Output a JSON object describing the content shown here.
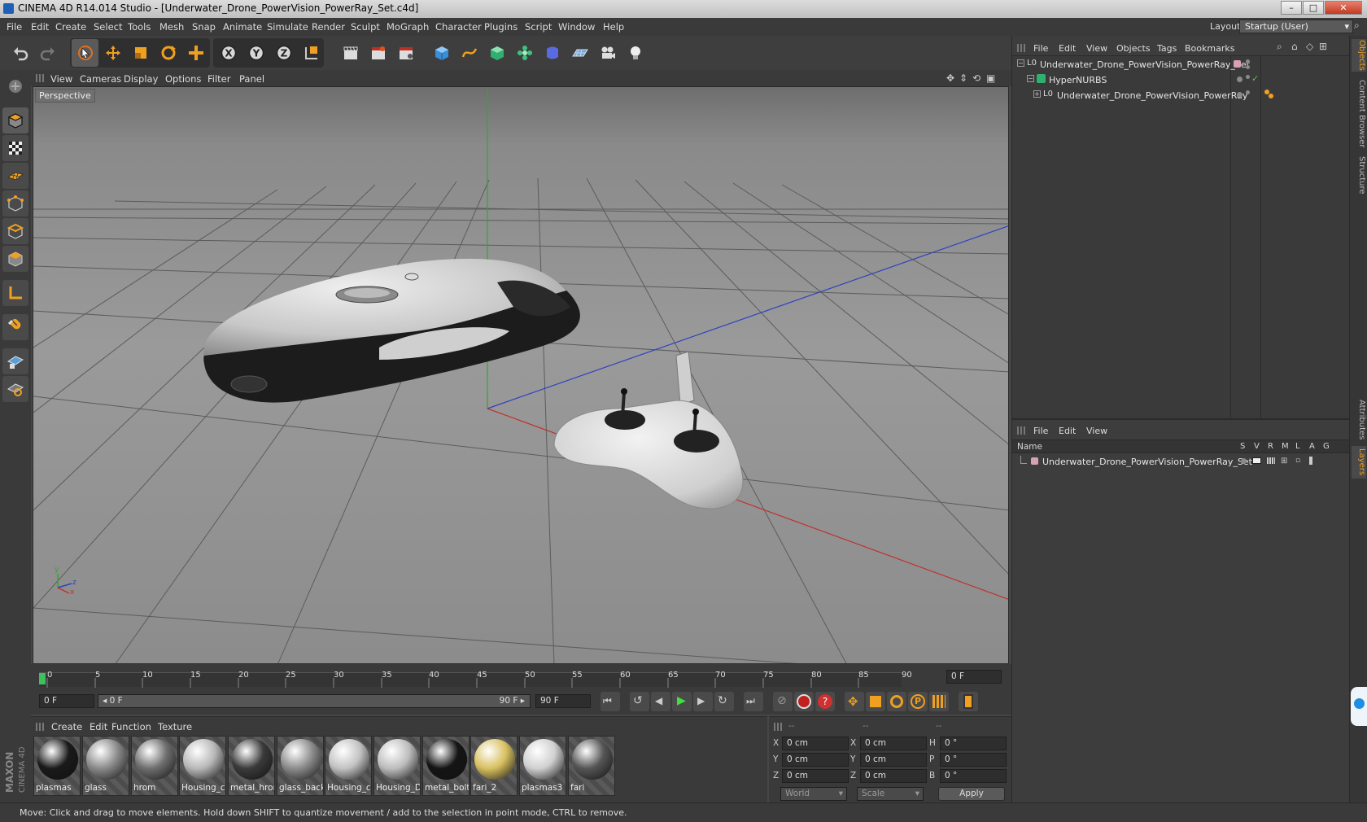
{
  "window": {
    "title": "CINEMA 4D R14.014 Studio - [Underwater_Drone_PowerVision_PowerRay_Set.c4d]",
    "btn_min": "–",
    "btn_max": "□",
    "btn_close": "✕"
  },
  "menu": [
    "File",
    "Edit",
    "Create",
    "Select",
    "Tools",
    "Mesh",
    "Snap",
    "Animate",
    "Simulate",
    "Render",
    "Sculpt",
    "MoGraph",
    "Character",
    "Plugins",
    "Script",
    "Window",
    "Help"
  ],
  "layout": {
    "label": "Layout:",
    "value": "Startup (User)"
  },
  "viewport": {
    "menu": [
      "View",
      "Cameras",
      "Display",
      "Options",
      "Filter",
      "Panel"
    ],
    "label": "Perspective",
    "axis_x": "x",
    "axis_y": "y",
    "axis_z": "z"
  },
  "timeline": {
    "ticks": [
      "0",
      "5",
      "10",
      "15",
      "20",
      "25",
      "30",
      "35",
      "40",
      "45",
      "50",
      "55",
      "60",
      "65",
      "70",
      "75",
      "80",
      "85",
      "90"
    ],
    "end_field": "0 F"
  },
  "transport": {
    "start": "0 F",
    "range_start": "◂ 0 F",
    "range_end": "90 F ▸",
    "end": "90 F"
  },
  "materials": {
    "menu": [
      "Create",
      "Edit",
      "Function",
      "Texture"
    ],
    "items": [
      {
        "name": "plasmas",
        "color": "#1a1a1a"
      },
      {
        "name": "glass",
        "color": "#8a8a8a"
      },
      {
        "name": "hrom",
        "color": "#6e6e6e"
      },
      {
        "name": "Housing_c",
        "color": "#b8b8b8"
      },
      {
        "name": "metal_hron",
        "color": "#3a3a3a"
      },
      {
        "name": "glass_back",
        "color": "#8c8c8c"
      },
      {
        "name": "Housing_c",
        "color": "#c2c2c2"
      },
      {
        "name": "Housing_D",
        "color": "#bdbdbd"
      },
      {
        "name": "metal_bolt",
        "color": "#151515"
      },
      {
        "name": "fari_2",
        "color": "#d8c060"
      },
      {
        "name": "plasmas3",
        "color": "#d0d0d0"
      },
      {
        "name": "fari",
        "color": "#555555"
      }
    ]
  },
  "coords": {
    "headers": [
      "--",
      "--",
      "--"
    ],
    "rows": [
      {
        "a": "X",
        "av": "0 cm",
        "b": "X",
        "bv": "0 cm",
        "c": "H",
        "cv": "0 °"
      },
      {
        "a": "Y",
        "av": "0 cm",
        "b": "Y",
        "bv": "0 cm",
        "c": "P",
        "cv": "0 °"
      },
      {
        "a": "Z",
        "av": "0 cm",
        "b": "Z",
        "bv": "0 cm",
        "c": "B",
        "cv": "0 °"
      }
    ],
    "world": "World",
    "scale": "Scale",
    "apply": "Apply"
  },
  "objects": {
    "menu": [
      "File",
      "Edit",
      "View",
      "Objects",
      "Tags",
      "Bookmarks"
    ],
    "tree": [
      {
        "label": "Underwater_Drone_PowerVision_PowerRay_Set"
      },
      {
        "label": "HyperNURBS"
      },
      {
        "label": "Underwater_Drone_PowerVision_PowerRay"
      }
    ]
  },
  "layers": {
    "menu": [
      "File",
      "Edit",
      "View"
    ],
    "name_header": "Name",
    "cols": [
      "S",
      "V",
      "R",
      "M",
      "L",
      "A",
      "G"
    ],
    "row": "Underwater_Drone_PowerVision_PowerRay_Set"
  },
  "side_tabs": [
    "Objects",
    "Content Browser",
    "Structure",
    "Attributes",
    "Layers"
  ],
  "logo": {
    "maxon": "MAXON",
    "c4d": "CINEMA 4D"
  },
  "status": "Move: Click and drag to move elements. Hold down SHIFT to quantize movement / add to the selection in point mode, CTRL to remove."
}
